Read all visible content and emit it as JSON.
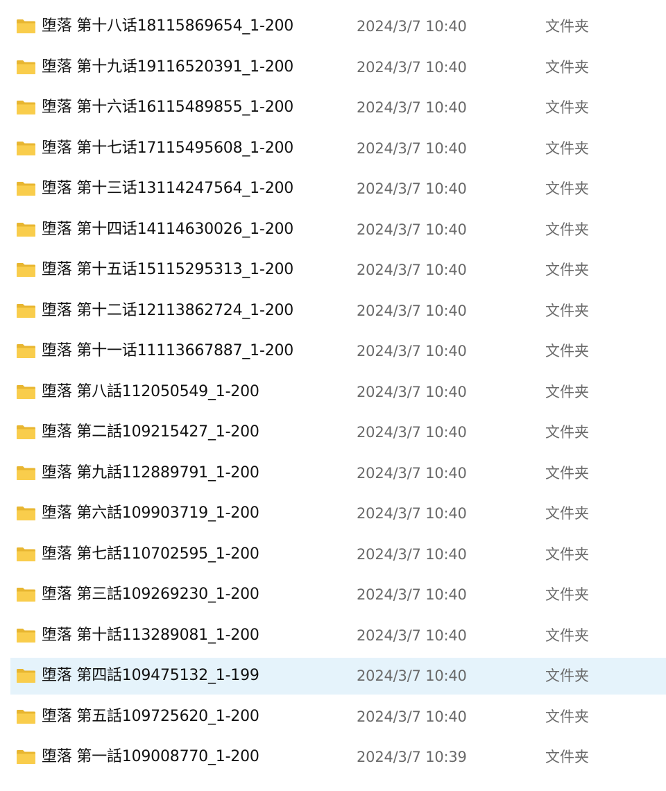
{
  "colors": {
    "folder_back": "#e8b631",
    "folder_front": "#f9cd4c",
    "selected_row": "#e5f3fb",
    "name_text": "#111111",
    "meta_text": "#6a6a6a"
  },
  "files": [
    {
      "name": "堕落   第十八话18115869654_1-200",
      "modified": "2024/3/7 10:40",
      "type": "文件夹",
      "icon": "folder-icon"
    },
    {
      "name": "堕落   第十九话19116520391_1-200",
      "modified": "2024/3/7 10:40",
      "type": "文件夹",
      "icon": "folder-icon"
    },
    {
      "name": "堕落   第十六话16115489855_1-200",
      "modified": "2024/3/7 10:40",
      "type": "文件夹",
      "icon": "folder-icon"
    },
    {
      "name": "堕落   第十七话17115495608_1-200",
      "modified": "2024/3/7 10:40",
      "type": "文件夹",
      "icon": "folder-icon"
    },
    {
      "name": "堕落   第十三话13114247564_1-200",
      "modified": "2024/3/7 10:40",
      "type": "文件夹",
      "icon": "folder-icon"
    },
    {
      "name": "堕落   第十四话14114630026_1-200",
      "modified": "2024/3/7 10:40",
      "type": "文件夹",
      "icon": "folder-icon"
    },
    {
      "name": "堕落   第十五话15115295313_1-200",
      "modified": "2024/3/7 10:40",
      "type": "文件夹",
      "icon": "folder-icon"
    },
    {
      "name": "堕落  第十二话12113862724_1-200",
      "modified": "2024/3/7 10:40",
      "type": "文件夹",
      "icon": "folder-icon"
    },
    {
      "name": "堕落  第十一话11113667887_1-200",
      "modified": "2024/3/7 10:40",
      "type": "文件夹",
      "icon": "folder-icon"
    },
    {
      "name": "堕落   第八話112050549_1-200",
      "modified": "2024/3/7 10:40",
      "type": "文件夹",
      "icon": "folder-icon"
    },
    {
      "name": "堕落   第二話109215427_1-200",
      "modified": "2024/3/7 10:40",
      "type": "文件夹",
      "icon": "folder-icon"
    },
    {
      "name": "堕落   第九話112889791_1-200",
      "modified": "2024/3/7 10:40",
      "type": "文件夹",
      "icon": "folder-icon"
    },
    {
      "name": "堕落   第六話109903719_1-200",
      "modified": "2024/3/7 10:40",
      "type": "文件夹",
      "icon": "folder-icon"
    },
    {
      "name": "堕落   第七話110702595_1-200",
      "modified": "2024/3/7 10:40",
      "type": "文件夹",
      "icon": "folder-icon"
    },
    {
      "name": "堕落   第三話109269230_1-200",
      "modified": "2024/3/7 10:40",
      "type": "文件夹",
      "icon": "folder-icon"
    },
    {
      "name": "堕落   第十話113289081_1-200",
      "modified": "2024/3/7 10:40",
      "type": "文件夹",
      "icon": "folder-icon"
    },
    {
      "name": "堕落   第四話109475132_1-199",
      "modified": "2024/3/7 10:40",
      "type": "文件夹",
      "icon": "folder-icon",
      "selected": true
    },
    {
      "name": "堕落   第五話109725620_1-200",
      "modified": "2024/3/7 10:40",
      "type": "文件夹",
      "icon": "folder-icon"
    },
    {
      "name": "堕落   第一話109008770_1-200",
      "modified": "2024/3/7 10:39",
      "type": "文件夹",
      "icon": "folder-icon"
    }
  ]
}
